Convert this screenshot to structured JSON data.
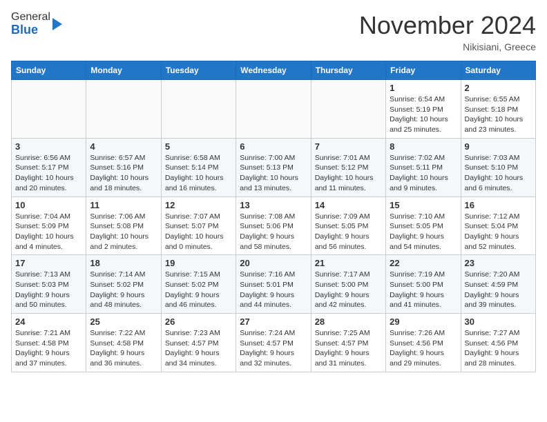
{
  "header": {
    "logo_general": "General",
    "logo_blue": "Blue",
    "month_title": "November 2024",
    "location": "Nikisiani, Greece"
  },
  "calendar": {
    "days_of_week": [
      "Sunday",
      "Monday",
      "Tuesday",
      "Wednesday",
      "Thursday",
      "Friday",
      "Saturday"
    ],
    "weeks": [
      [
        {
          "day": "",
          "info": ""
        },
        {
          "day": "",
          "info": ""
        },
        {
          "day": "",
          "info": ""
        },
        {
          "day": "",
          "info": ""
        },
        {
          "day": "",
          "info": ""
        },
        {
          "day": "1",
          "info": "Sunrise: 6:54 AM\nSunset: 5:19 PM\nDaylight: 10 hours\nand 25 minutes."
        },
        {
          "day": "2",
          "info": "Sunrise: 6:55 AM\nSunset: 5:18 PM\nDaylight: 10 hours\nand 23 minutes."
        }
      ],
      [
        {
          "day": "3",
          "info": "Sunrise: 6:56 AM\nSunset: 5:17 PM\nDaylight: 10 hours\nand 20 minutes."
        },
        {
          "day": "4",
          "info": "Sunrise: 6:57 AM\nSunset: 5:16 PM\nDaylight: 10 hours\nand 18 minutes."
        },
        {
          "day": "5",
          "info": "Sunrise: 6:58 AM\nSunset: 5:14 PM\nDaylight: 10 hours\nand 16 minutes."
        },
        {
          "day": "6",
          "info": "Sunrise: 7:00 AM\nSunset: 5:13 PM\nDaylight: 10 hours\nand 13 minutes."
        },
        {
          "day": "7",
          "info": "Sunrise: 7:01 AM\nSunset: 5:12 PM\nDaylight: 10 hours\nand 11 minutes."
        },
        {
          "day": "8",
          "info": "Sunrise: 7:02 AM\nSunset: 5:11 PM\nDaylight: 10 hours\nand 9 minutes."
        },
        {
          "day": "9",
          "info": "Sunrise: 7:03 AM\nSunset: 5:10 PM\nDaylight: 10 hours\nand 6 minutes."
        }
      ],
      [
        {
          "day": "10",
          "info": "Sunrise: 7:04 AM\nSunset: 5:09 PM\nDaylight: 10 hours\nand 4 minutes."
        },
        {
          "day": "11",
          "info": "Sunrise: 7:06 AM\nSunset: 5:08 PM\nDaylight: 10 hours\nand 2 minutes."
        },
        {
          "day": "12",
          "info": "Sunrise: 7:07 AM\nSunset: 5:07 PM\nDaylight: 10 hours\nand 0 minutes."
        },
        {
          "day": "13",
          "info": "Sunrise: 7:08 AM\nSunset: 5:06 PM\nDaylight: 9 hours\nand 58 minutes."
        },
        {
          "day": "14",
          "info": "Sunrise: 7:09 AM\nSunset: 5:05 PM\nDaylight: 9 hours\nand 56 minutes."
        },
        {
          "day": "15",
          "info": "Sunrise: 7:10 AM\nSunset: 5:05 PM\nDaylight: 9 hours\nand 54 minutes."
        },
        {
          "day": "16",
          "info": "Sunrise: 7:12 AM\nSunset: 5:04 PM\nDaylight: 9 hours\nand 52 minutes."
        }
      ],
      [
        {
          "day": "17",
          "info": "Sunrise: 7:13 AM\nSunset: 5:03 PM\nDaylight: 9 hours\nand 50 minutes."
        },
        {
          "day": "18",
          "info": "Sunrise: 7:14 AM\nSunset: 5:02 PM\nDaylight: 9 hours\nand 48 minutes."
        },
        {
          "day": "19",
          "info": "Sunrise: 7:15 AM\nSunset: 5:02 PM\nDaylight: 9 hours\nand 46 minutes."
        },
        {
          "day": "20",
          "info": "Sunrise: 7:16 AM\nSunset: 5:01 PM\nDaylight: 9 hours\nand 44 minutes."
        },
        {
          "day": "21",
          "info": "Sunrise: 7:17 AM\nSunset: 5:00 PM\nDaylight: 9 hours\nand 42 minutes."
        },
        {
          "day": "22",
          "info": "Sunrise: 7:19 AM\nSunset: 5:00 PM\nDaylight: 9 hours\nand 41 minutes."
        },
        {
          "day": "23",
          "info": "Sunrise: 7:20 AM\nSunset: 4:59 PM\nDaylight: 9 hours\nand 39 minutes."
        }
      ],
      [
        {
          "day": "24",
          "info": "Sunrise: 7:21 AM\nSunset: 4:58 PM\nDaylight: 9 hours\nand 37 minutes."
        },
        {
          "day": "25",
          "info": "Sunrise: 7:22 AM\nSunset: 4:58 PM\nDaylight: 9 hours\nand 36 minutes."
        },
        {
          "day": "26",
          "info": "Sunrise: 7:23 AM\nSunset: 4:57 PM\nDaylight: 9 hours\nand 34 minutes."
        },
        {
          "day": "27",
          "info": "Sunrise: 7:24 AM\nSunset: 4:57 PM\nDaylight: 9 hours\nand 32 minutes."
        },
        {
          "day": "28",
          "info": "Sunrise: 7:25 AM\nSunset: 4:57 PM\nDaylight: 9 hours\nand 31 minutes."
        },
        {
          "day": "29",
          "info": "Sunrise: 7:26 AM\nSunset: 4:56 PM\nDaylight: 9 hours\nand 29 minutes."
        },
        {
          "day": "30",
          "info": "Sunrise: 7:27 AM\nSunset: 4:56 PM\nDaylight: 9 hours\nand 28 minutes."
        }
      ]
    ]
  }
}
